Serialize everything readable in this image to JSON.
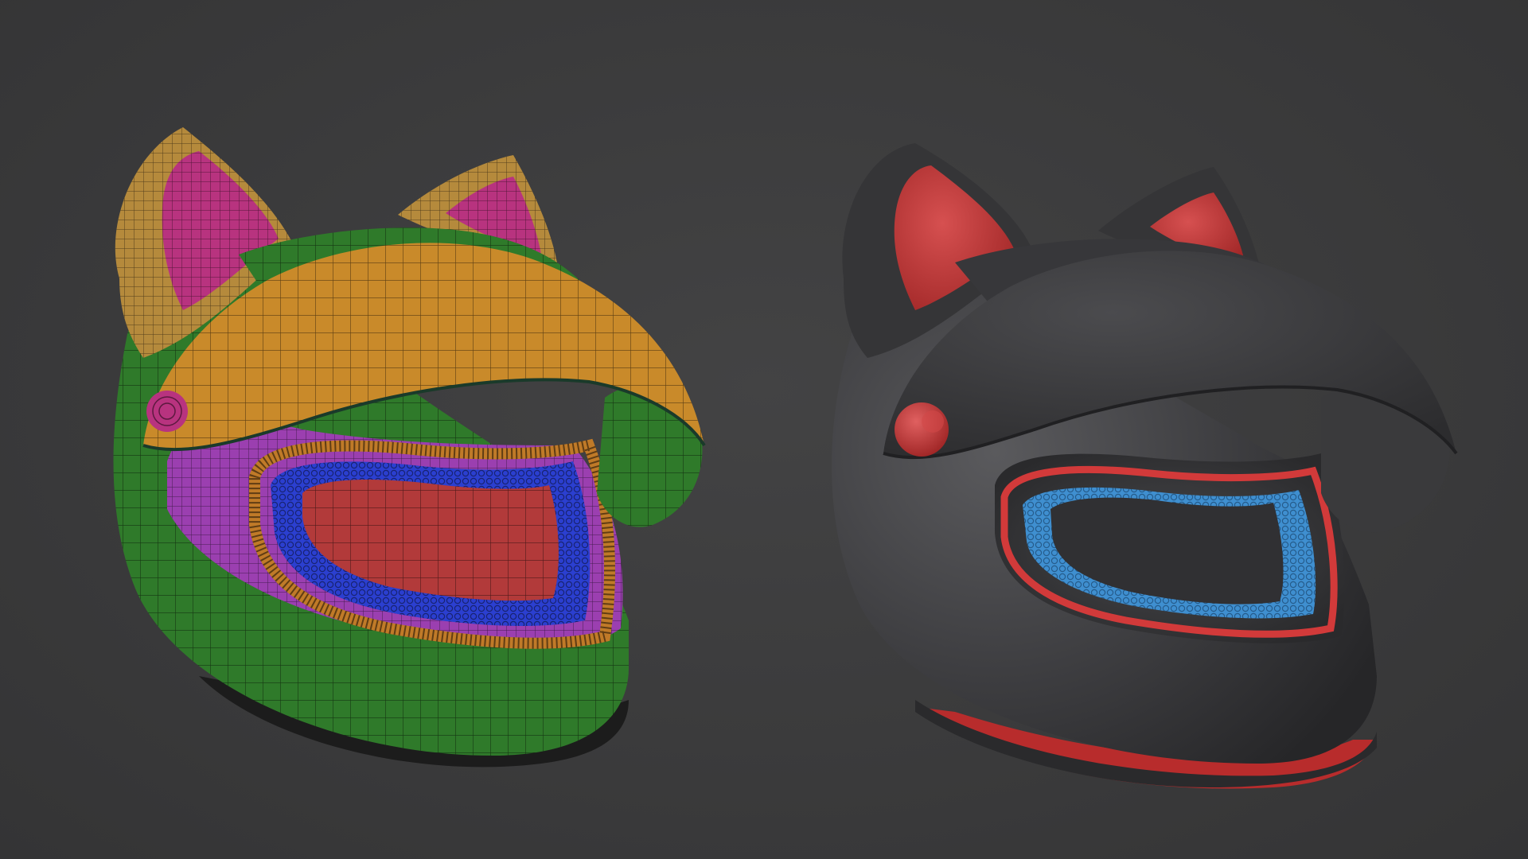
{
  "scene": {
    "background_color": "#3b3b3c",
    "models": [
      {
        "name": "cat-ear-helmet-polygroups",
        "render_mode": "wireframe-polygroups",
        "colors": {
          "shell": "#2f7a2a",
          "visor": "#c98a2a",
          "ear_outer": "#b58a3c",
          "ear_inner": "#b8337f",
          "inner_rim": "#9b3fb0",
          "padding": "#2b3fd0",
          "face_lining": "#b23a3a",
          "trim": "#c07a28"
        }
      },
      {
        "name": "cat-ear-helmet-shaded",
        "render_mode": "matcap-shaded",
        "colors": {
          "shell": "#3e3e40",
          "visor": "#3a3a3c",
          "ear_inner": "#c43a3a",
          "accent_trim": "#d23a3a",
          "padding": "#3f8fd0",
          "button": "#c33434"
        }
      }
    ]
  }
}
